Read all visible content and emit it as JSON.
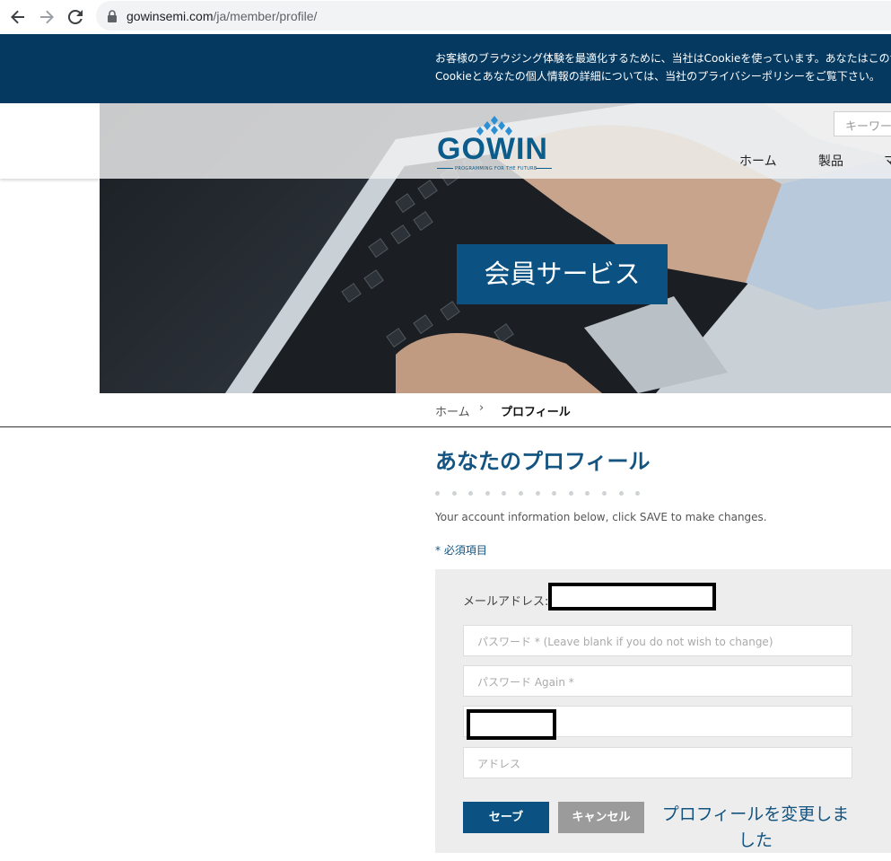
{
  "browser": {
    "url_domain": "gowinsemi.com",
    "url_path": "/ja/member/profile/"
  },
  "cookie_notice": {
    "line1": "お客様のブラウジング体験を最適化するために、当社はCookieを使っています。あなたはこのサ",
    "line2": "Cookieとあなたの個人情報の詳細については、当社のプライバシーポリシーをご覧下さい。"
  },
  "header": {
    "logo_text": "GOWIN",
    "logo_tagline": "PROGRAMMING FOR THE FUTURE",
    "search_placeholder": "キーワー",
    "nav": [
      "ホーム",
      "製品",
      "マ"
    ]
  },
  "hero": {
    "title": "会員サービス"
  },
  "breadcrumb": {
    "home": "ホーム",
    "separator": "›",
    "current": "プロフィール"
  },
  "page": {
    "title": "あなたのプロフィール",
    "description": "Your account information below, click SAVE to make changes.",
    "required_note": "* 必須項目"
  },
  "form": {
    "email_label": "メールアドレス:",
    "password_placeholder": "パスワード * (Leave blank if you do not wish to change)",
    "password_again_placeholder": "パスワード Again *",
    "address_placeholder": "アドレス",
    "save_label": "セーブ",
    "cancel_label": "キャンセル",
    "success_message": "プロフィールを変更しました"
  },
  "colors": {
    "brand_blue": "#0b5282",
    "cookie_bar": "#06395f",
    "title_blue": "#145481"
  }
}
